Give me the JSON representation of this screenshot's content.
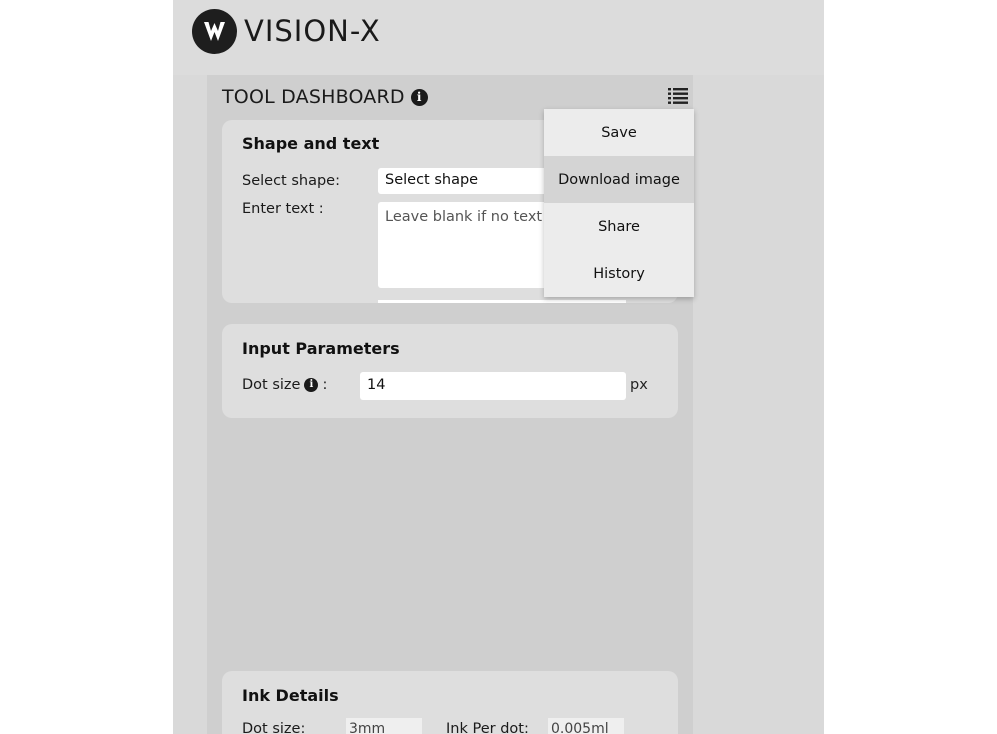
{
  "brand": {
    "name": "VISION-X"
  },
  "dashboard": {
    "title": "TOOL DASHBOARD",
    "info_glyph": "i"
  },
  "menu": {
    "icon": "list-icon",
    "items": [
      "Save",
      "Download image",
      "Share",
      "History"
    ],
    "active": "Download image"
  },
  "shape_text": {
    "title": "Shape and text",
    "select_label": "Select shape:",
    "select_value": "Select shape",
    "text_label": "Enter text :",
    "text_placeholder": "Leave blank if no text to Braille"
  },
  "input_params": {
    "title": "Input Parameters",
    "dot_size_label_pre": "Dot size",
    "dot_size_label_post": ":",
    "dot_size_value": "14",
    "unit": "px"
  },
  "ink": {
    "title": "Ink Details",
    "dot_size_label": "Dot size:",
    "dot_size_value": "3mm",
    "ink_per_dot_label": "Ink Per dot:",
    "ink_per_dot_value": "0.005ml"
  }
}
